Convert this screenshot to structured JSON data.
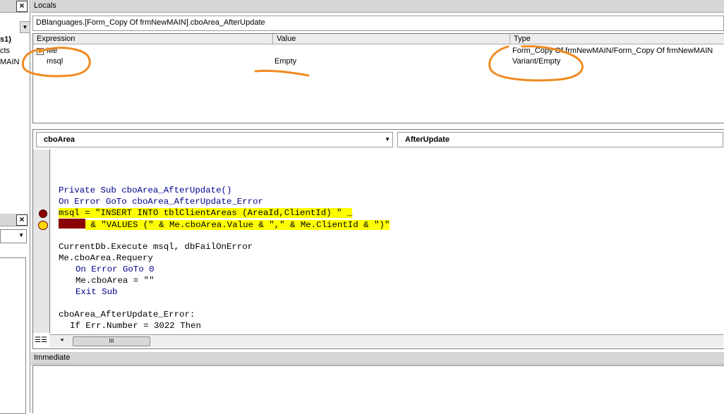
{
  "left_panel": {
    "items": [
      "s1)",
      "cts",
      "MAIN"
    ],
    "close_label": "×"
  },
  "locals": {
    "title": "Locals",
    "context_path": "DBlanguages.[Form_Copy Of frmNewMAIN].cboArea_AfterUpdate",
    "columns": [
      "Expression",
      "Value",
      "Type"
    ],
    "rows": [
      {
        "expand": "+",
        "expression": "Me",
        "value": "",
        "type": "Form_Copy Of frmNewMAIN/Form_Copy Of frmNewMAIN"
      },
      {
        "expand": "",
        "expression": "msql",
        "value": "Empty",
        "type": "Variant/Empty"
      }
    ]
  },
  "code_window": {
    "object_combo": "cboArea",
    "procedure_combo": "AfterUpdate",
    "lines": [
      "Private Sub cboArea_AfterUpdate()",
      "On Error GoTo cboArea_AfterUpdate_Error",
      "msql = \"INSERT INTO tblClientAreas (AreaId,ClientId) \" _",
      "& \"VALUES (\" & Me.cboArea.Value & \",\" & Me.ClientId & \")\"",
      "CurrentDb.Execute msql, dbFailOnError",
      "Me.cboArea.Requery",
      "On Error GoTo 0",
      "Me.cboArea = \"\"",
      "Exit Sub",
      "cboArea_AfterUpdate_Error:",
      "If Err.Number = 3022 Then"
    ],
    "scroll_thumb": "III"
  },
  "immediate": {
    "title": "Immediate"
  },
  "colors": {
    "annotation": "#f08a20",
    "highlight": "#ffff00",
    "breakpoint": "#8b0000",
    "keyword": "#00008b"
  }
}
